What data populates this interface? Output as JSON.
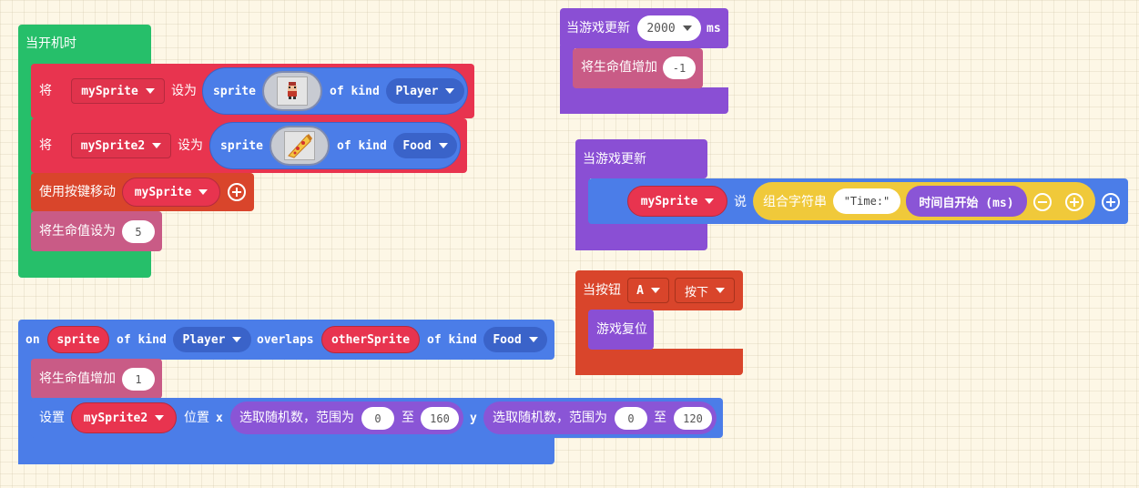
{
  "colors": {
    "event_green": "#26bf6a",
    "sprite_red": "#e8344f",
    "var_pill_red": "#e0334c",
    "controller_orange": "#d9452b",
    "info_pink": "#c95b86",
    "sprites_blue": "#4b7de8",
    "kind_blue": "#3a63c9",
    "game_purple": "#8a4fd4",
    "math_purple": "#8a55d6",
    "text_yellow": "#f0c93a"
  },
  "block_start": {
    "hat": "当开机时",
    "row1": {
      "set": "将",
      "var": "mySprite",
      "to": "设为",
      "sprite": "sprite",
      "image_icon": "player-sprite-icon",
      "of_kind": "of kind",
      "kind": "Player"
    },
    "row2": {
      "set": "将",
      "var": "mySprite2",
      "to": "设为",
      "sprite": "sprite",
      "image_icon": "pizza-sprite-icon",
      "of_kind": "of kind",
      "kind": "Food"
    },
    "row3": {
      "label": "使用按键移动",
      "var": "mySprite"
    },
    "row4": {
      "label": "将生命值设为",
      "value": "5"
    }
  },
  "block_interval": {
    "hat": "当游戏更新",
    "interval": "2000",
    "unit": "ms",
    "inner": {
      "label": "将生命值增加",
      "value": "-1"
    }
  },
  "block_update": {
    "hat": "当游戏更新",
    "var": "mySprite",
    "say": "说",
    "join": "组合字符串",
    "text": "\"Time:\"",
    "time": "时间自开始 (ms)"
  },
  "block_button": {
    "hat": "当按钮",
    "button": "A",
    "action": "按下",
    "inner": "游戏复位"
  },
  "block_overlap": {
    "on": "on",
    "sprite": "sprite",
    "of_kind1": "of kind",
    "kind1": "Player",
    "overlaps": "overlaps",
    "other": "otherSprite",
    "of_kind2": "of kind",
    "kind2": "Food",
    "row1": {
      "label": "将生命值增加",
      "value": "1"
    },
    "row2": {
      "set": "设置",
      "var": "mySprite2",
      "pos": "位置",
      "x": "x",
      "rand1": "选取随机数，范围为",
      "min1": "0",
      "to1": "至",
      "max1": "160",
      "y": "y",
      "rand2": "选取随机数，范围为",
      "min2": "0",
      "to2": "至",
      "max2": "120"
    }
  }
}
